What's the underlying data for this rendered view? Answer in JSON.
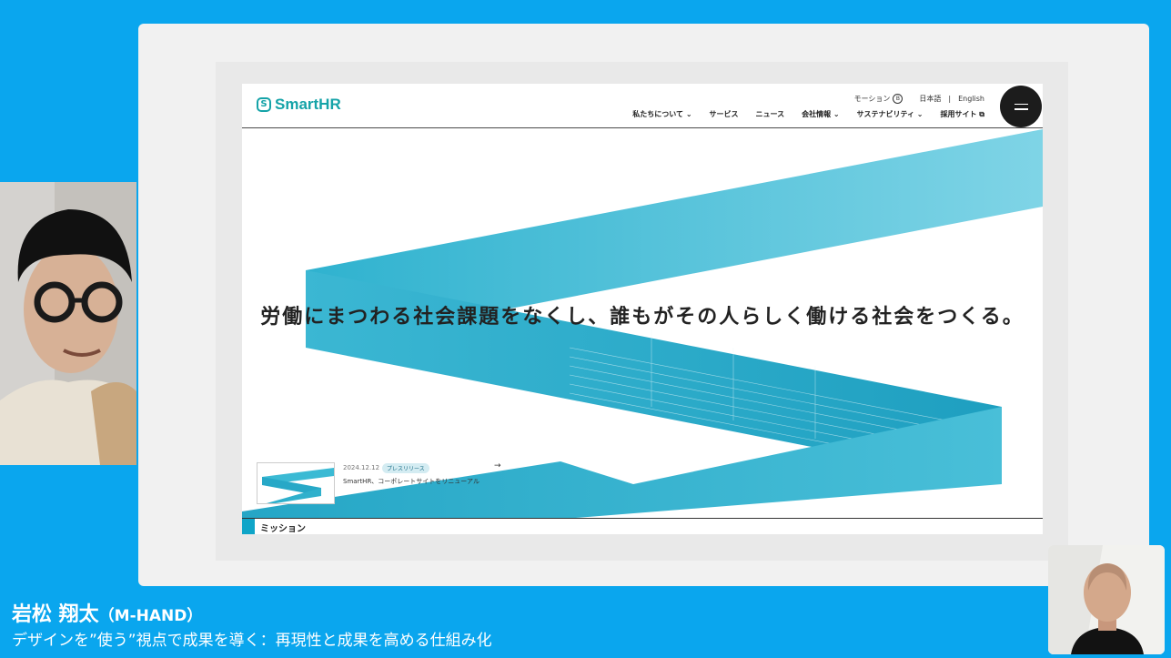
{
  "site": {
    "logo_text": "SmartHR",
    "logo_mark": "S",
    "util": {
      "motion_label": "モーション",
      "motion_badge": "B",
      "lang_ja": "日本語",
      "lang_sep": "|",
      "lang_en": "English"
    },
    "nav": [
      "私たちについて ⌄",
      "サービス",
      "ニュース",
      "会社情報 ⌄",
      "サステナビリティ ⌄",
      "採用サイト ⧉"
    ],
    "menu_icon": "hamburger-icon",
    "hero_title": "労働にまつわる社会課題をなくし、誰もがその人らしく働ける社会をつくる。",
    "news": {
      "date": "2024.12.12",
      "tag": "プレスリリース",
      "title": "SmartHR、コーポレートサイトをリニューアル",
      "arrow": "→"
    },
    "section_label": "ミッション",
    "accent_color": "#1ab4cf"
  },
  "presentation": {
    "speaker_name": "岩松 翔太",
    "speaker_org": "（M-HAND）",
    "talk_title": "デザインを”使う”視点で成果を導く：再現性と成果を高める仕組み化",
    "background_color": "#0aa6ee"
  }
}
